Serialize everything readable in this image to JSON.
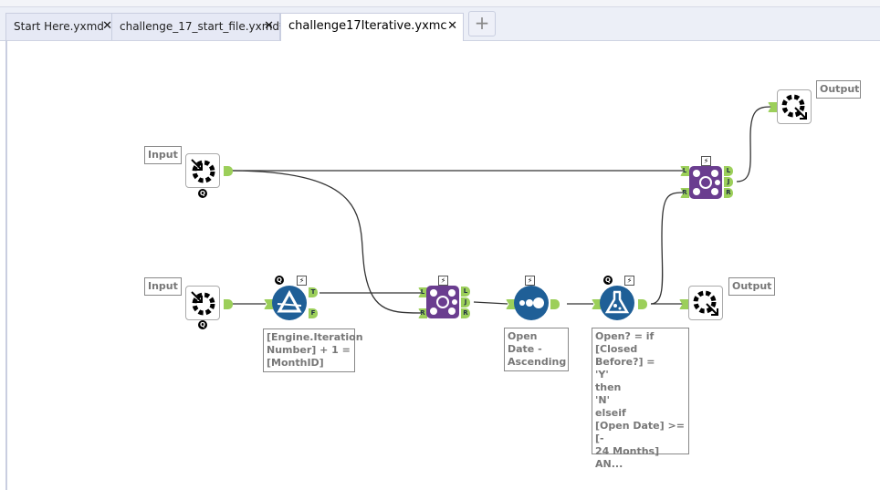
{
  "tabs": [
    {
      "label": "Start Here.yxmd",
      "active": false
    },
    {
      "label": "challenge_17_start_file.yxmd*",
      "active": false
    },
    {
      "label": "challenge17Iterative.yxmc",
      "active": true
    }
  ],
  "tab_close": "✕",
  "new_tab": "+",
  "canvas": {
    "input1_label": "Input",
    "input2_label": "Input",
    "output1_label": "Output",
    "output2_label": "Output",
    "filter_annotation": "[Engine.Iteration Number] + 1 = [MonthID]",
    "sort_annotation": "Open Date - Ascending",
    "formula_annotation": [
      "Open? = if",
      "[Closed Before?] =",
      "'Y'",
      "then",
      "'N'",
      "elseif",
      "[Open Date] >= [-",
      "24 Months]",
      "AN..."
    ],
    "anchors": {
      "true": "T",
      "false": "F",
      "left": "L",
      "join": "J",
      "right": "R"
    },
    "badge_q": "Q",
    "badge_bolt": "⚡",
    "colors": {
      "tool_blue": "#1f5f97",
      "join_purple": "#6a3d8f",
      "anchor_green": "#9ccf5a"
    }
  }
}
